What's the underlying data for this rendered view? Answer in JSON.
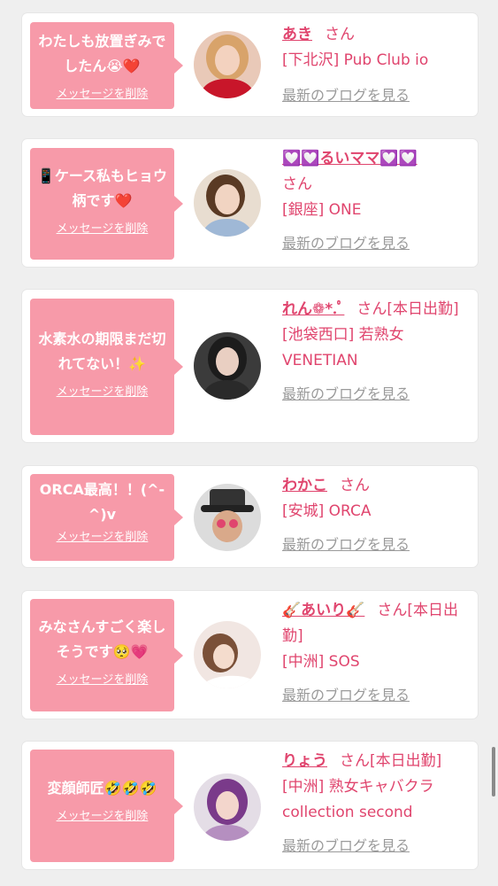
{
  "colors": {
    "bubble": "#f79aa9",
    "accent": "#e0456e",
    "link_gray": "#9a9a9a",
    "background": "#efefef",
    "card": "#ffffff"
  },
  "cards": [
    {
      "message": "わたしも放置ぎみでしたん😭❤️",
      "delete_label": "メッセージを削除",
      "name": "あき",
      "suffix": "さん",
      "shop": "[下北沢] Pub Club io",
      "blog_label": "最新のブログを見る",
      "avatar": "woman-red-top-photo"
    },
    {
      "message": "📱ケース私もヒョウ柄です❤️",
      "delete_label": "メッセージを削除",
      "name": "💟💟るいママ💟💟",
      "suffix": "さん",
      "shop": "[銀座] ONE",
      "blog_label": "最新のブログを見る",
      "avatar": "woman-selfie-photo"
    },
    {
      "message": "水素水の期限まだ切れてない！✨",
      "delete_label": "メッセージを削除",
      "name": "れん❁*.ﾟ",
      "suffix": "さん[本日出勤]",
      "shop": "[池袋西口] 若熟女VENETIAN",
      "blog_label": "最新のブログを見る",
      "avatar": "woman-dark-room-photo"
    },
    {
      "message": "ORCA最高！！(^-^)v",
      "delete_label": "メッセージを削除",
      "name": "わかこ",
      "suffix": "さん",
      "shop": "[安城] ORCA",
      "blog_label": "最新のブログを見る",
      "avatar": "man-with-hat-photo"
    },
    {
      "message": "みなさんすごく楽しそうです🥺💗",
      "delete_label": "メッセージを削除",
      "name": "🎸あいり🎸",
      "suffix": "さん[本日出勤]",
      "shop": "[中洲] SOS",
      "blog_label": "最新のブログを見る",
      "avatar": "woman-lying-photo"
    },
    {
      "message": "変顔師匠🤣🤣🤣",
      "delete_label": "メッセージを削除",
      "name": "りょう",
      "suffix": "さん[本日出勤]",
      "shop": "[中洲] 熟女キャバクラcollection second",
      "blog_label": "最新のブログを見る",
      "avatar": "woman-purple-hair-photo"
    }
  ]
}
